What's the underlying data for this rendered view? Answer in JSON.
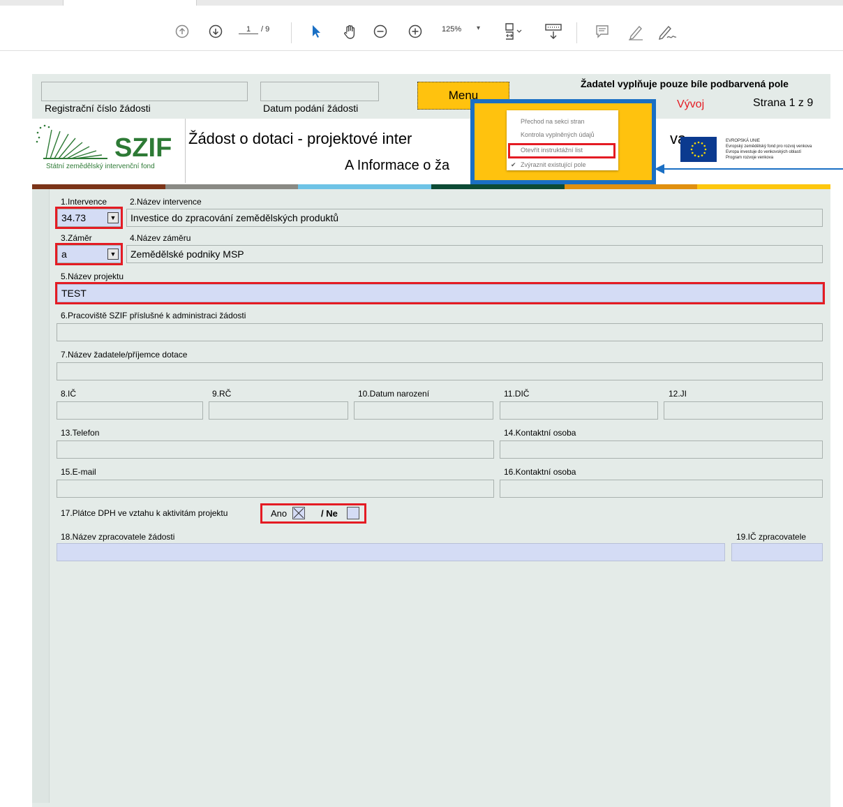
{
  "toolbar": {
    "page_current": "1",
    "page_total": "/ 9",
    "zoom": "125%"
  },
  "header": {
    "reg_label": "Registrační číslo žádosti",
    "date_label": "Datum podání žádosti",
    "menu_label": "Menu",
    "fill_note": "Žadatel vyplňuje pouze bíle podbarvená pole",
    "vyvoj": "Vývoj",
    "strana": "Strana 1 z 9"
  },
  "logo": {
    "szif": "SZIF",
    "szif_sub": "Státní zemědělský intervenční fond",
    "title": "Žádost o dotaci - projektové inter",
    "title_end": "va",
    "section": "A Informace o ža",
    "eu_lines": [
      "EVROPSKÁ UNIE",
      "Evropský zemědělský fond pro rozvoj venkova",
      "Evropa investuje do venkovských oblastí",
      "Program rozvoje venkova"
    ]
  },
  "popup": {
    "items": [
      "Přechod na sekci stran",
      "Kontrola vyplněných údajů",
      "Otevřít instruktážní list",
      "Zvýraznit existující pole"
    ],
    "checked_item": "Zvýraznit existující pole"
  },
  "form": {
    "f1_label": "1.Intervence",
    "f1_value": "34.73",
    "f2_label": "2.Název intervence",
    "f2_value": "Investice do zpracování zemědělských produktů",
    "f3_label": "3.Záměr",
    "f3_value": "a",
    "f4_label": "4.Název záměru",
    "f4_value": "Zemědělské podniky MSP",
    "f5_label": "5.Název projektu",
    "f5_value": "TEST",
    "f6_label": "6.Pracoviště SZIF příslušné k administraci žádosti",
    "f7_label": "7.Název žadatele/příjemce dotace",
    "f8_label": "8.IČ",
    "f9_label": "9.RČ",
    "f10_label": "10.Datum narození",
    "f11_label": "11.DIČ",
    "f12_label": "12.JI",
    "f13_label": "13.Telefon",
    "f14_label": "14.Kontaktní osoba",
    "f15_label": "15.E-mail",
    "f16_label": "16.Kontaktní osoba",
    "f17_label": "17.Plátce DPH ve vztahu k aktivitám projektu",
    "f17_ano": "Ano",
    "f17_ne": "/ Ne",
    "f18_label": "18.Název zpracovatele žádosti",
    "f19_label": "19.IČ zpracovatele"
  },
  "colors": {
    "stripe": [
      "#7b3418",
      "#8a8a84",
      "#6ec3e6",
      "#0d4b35",
      "#e0900f",
      "#fdc70e"
    ],
    "highlight_red": "#e41b23",
    "popup_blue": "#1a6fc4",
    "menu_yellow": "#ffc20e"
  }
}
